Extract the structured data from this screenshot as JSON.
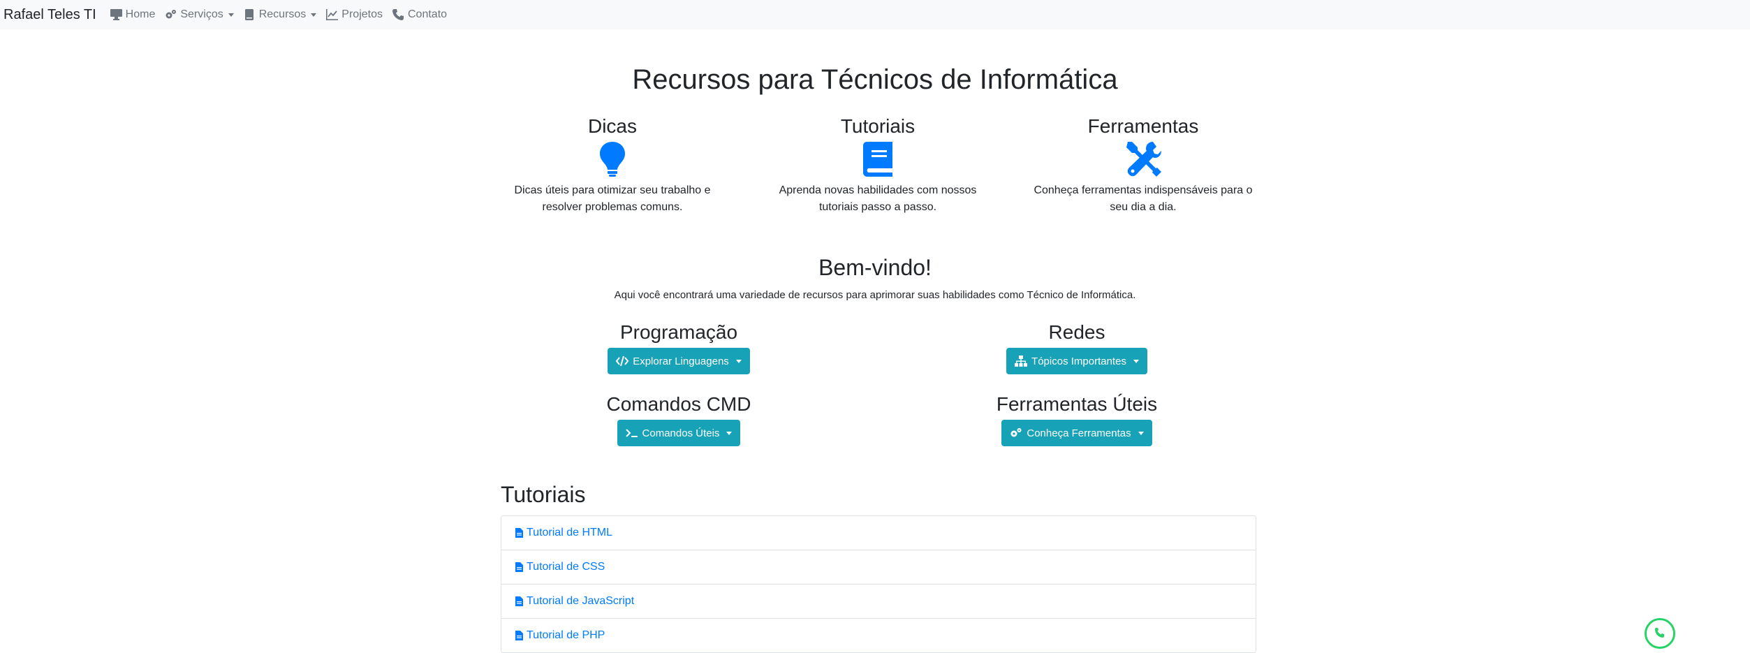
{
  "navbar": {
    "brand": "Rafael Teles TI",
    "items": [
      {
        "label": "Home",
        "icon": "desktop-icon"
      },
      {
        "label": "Serviços",
        "icon": "cogs-icon",
        "dropdown": true
      },
      {
        "label": "Recursos",
        "icon": "book-icon",
        "dropdown": true
      },
      {
        "label": "Projetos",
        "icon": "chart-line-icon"
      },
      {
        "label": "Contato",
        "icon": "phone-icon"
      }
    ]
  },
  "page_title": "Recursos para Técnicos de Informática",
  "features": [
    {
      "title": "Dicas",
      "icon": "lightbulb-icon",
      "text": "Dicas úteis para otimizar seu trabalho e resolver problemas comuns."
    },
    {
      "title": "Tutoriais",
      "icon": "book-icon",
      "text": "Aprenda novas habilidades com nossos tutoriais passo a passo."
    },
    {
      "title": "Ferramentas",
      "icon": "tools-icon",
      "text": "Conheça ferramentas indispensáveis para o seu dia a dia."
    }
  ],
  "welcome": {
    "title": "Bem-vindo!",
    "text": "Aqui você encontrará uma variedade de recursos para aprimorar suas habilidades como Técnico de Informática."
  },
  "categories": [
    {
      "title": "Programação",
      "button": "Explorar Linguagens",
      "icon": "code-icon"
    },
    {
      "title": "Redes",
      "button": "Tópicos Importantes",
      "icon": "network-icon"
    },
    {
      "title": "Comandos CMD",
      "button": "Comandos Úteis",
      "icon": "terminal-icon"
    },
    {
      "title": "Ferramentas Úteis",
      "button": "Conheça Ferramentas",
      "icon": "cogs-icon"
    }
  ],
  "tutorials": {
    "title": "Tutoriais",
    "items": [
      "Tutorial de HTML",
      "Tutorial de CSS",
      "Tutorial de JavaScript",
      "Tutorial de PHP"
    ]
  },
  "colors": {
    "accent": "#007bff",
    "button": "#17a2b8",
    "navbar_bg": "#f8f9fa",
    "whatsapp": "#25d366"
  }
}
